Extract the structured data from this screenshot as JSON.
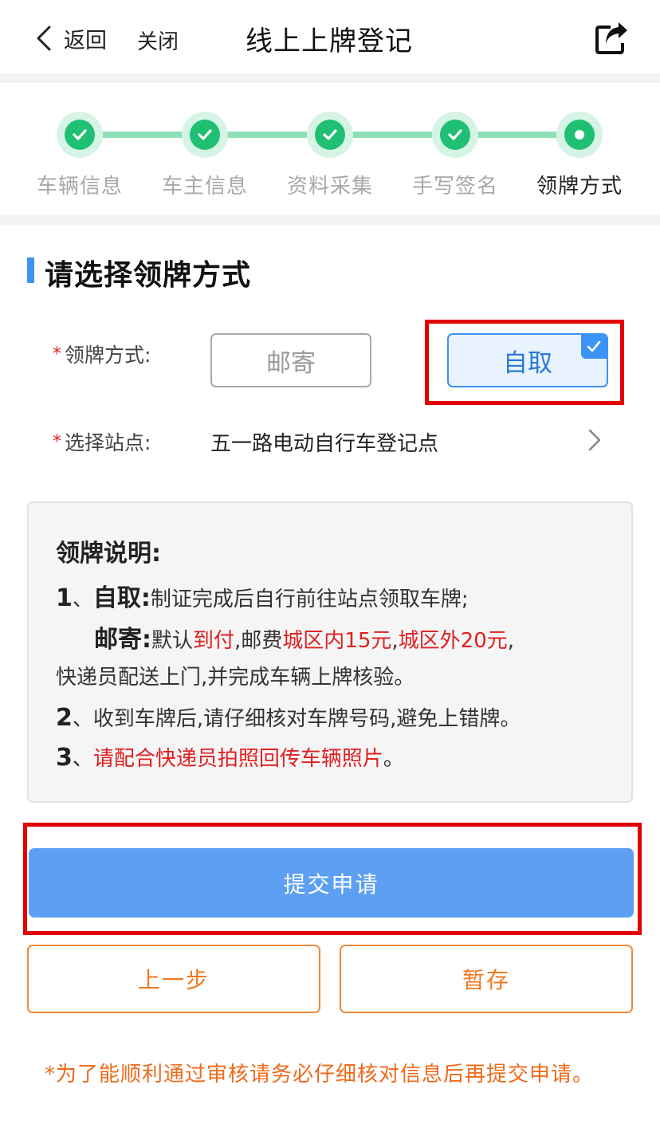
{
  "header": {
    "back_label": "返回",
    "close_label": "关闭",
    "title": "线上上牌登记",
    "back_icon": "chevron-left-icon",
    "share_icon": "share-icon"
  },
  "steps": {
    "items": [
      {
        "label": "车辆信息",
        "state": "done"
      },
      {
        "label": "车主信息",
        "state": "done"
      },
      {
        "label": "资料采集",
        "state": "done"
      },
      {
        "label": "手写签名",
        "state": "done"
      },
      {
        "label": "领牌方式",
        "state": "current"
      }
    ],
    "colors": {
      "done": "#1fbf74",
      "line": "#8ee0b7"
    }
  },
  "section": {
    "title": "请选择领牌方式"
  },
  "form": {
    "required_mark": "*",
    "method_label": "领牌方式:",
    "method_options": [
      {
        "label": "邮寄",
        "selected": false
      },
      {
        "label": "自取",
        "selected": true
      }
    ],
    "station_label": "选择站点:",
    "station_value": "五一路电动自行车登记点"
  },
  "note": {
    "title": "领牌说明:",
    "line1": {
      "num": "1",
      "sep": "、",
      "key": "自取:",
      "text": "制证完成后自行前往站点领取车牌;"
    },
    "line2": {
      "key": "邮寄:",
      "t1": "默认",
      "r1": "到付",
      "t2": ",邮费",
      "r2": "城区内15元",
      "t3": ",",
      "r3": "城区外20元",
      "t4": ","
    },
    "line3": "快递员配送上门,并完成车辆上牌核验。",
    "line4": {
      "num": "2",
      "text": "、收到车牌后,请仔细核对车牌号码,避免上错牌。"
    },
    "line5": {
      "num": "3",
      "sep": "、",
      "red": "请配合快递员拍照回传车辆照片",
      "end": "。"
    }
  },
  "buttons": {
    "submit": "提交申请",
    "prev": "上一步",
    "save": "暂存"
  },
  "footer": {
    "note": "*为了能顺利通过审核请务必仔细核对信息后再提交申请。"
  },
  "colors": {
    "accent": "#3a93f5",
    "submit_bg": "#5d9ff2",
    "warning": "#ef7a20",
    "required": "#e02020",
    "highlight_box": "#e30000"
  }
}
